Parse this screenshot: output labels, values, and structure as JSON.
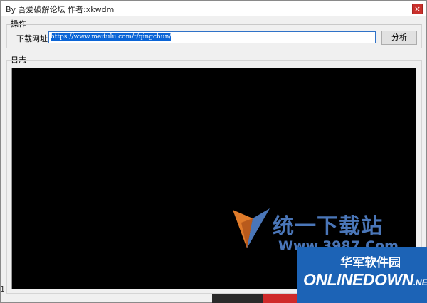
{
  "window": {
    "title": "By 吾爱破解论坛  作者:xkwdm",
    "close_glyph": "×"
  },
  "ops_group": {
    "label": "操作",
    "url_label": "下载网址:",
    "url_value": "https://www.meitulu.com/t/qingchun/",
    "analyze_label": "分析"
  },
  "log_group": {
    "label": "日志"
  },
  "watermarks": {
    "site1_name": "统一下载站",
    "site1_sub": "Www.3987.Com",
    "site2_name_cn": "华军软件园",
    "site2_name_en": "ONLINEDOWN",
    "site2_suffix": ".NET"
  },
  "edge_text": "1",
  "colors": {
    "log_bg": "#000000",
    "selection": "#0a64d6",
    "close_bg": "#c9302c",
    "watermark_blue": "#1c63b6"
  }
}
